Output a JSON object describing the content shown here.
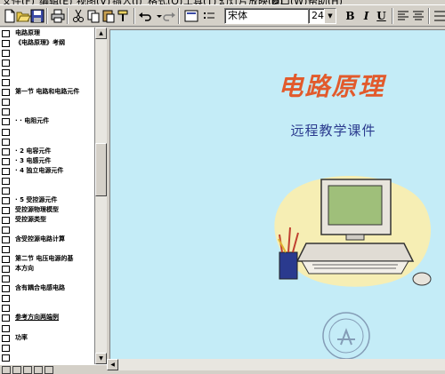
{
  "menubar": {
    "items": [
      "文件(F)",
      "编辑(E)",
      "视图(V)",
      "插入(I)",
      "格式(O)",
      "工具(T)",
      "幻灯片放映(D)",
      "窗口(W)",
      "帮助(H)"
    ]
  },
  "toolbar": {
    "font_name": "宋体",
    "font_size": "24",
    "bold_label": "B",
    "italic_label": "I",
    "underline_label": "U"
  },
  "outline": {
    "items": [
      {
        "text": "电路原理"
      },
      {
        "text": "《电路原理》考纲"
      },
      {
        "text": ""
      },
      {
        "text": ""
      },
      {
        "text": ""
      },
      {
        "text": ""
      },
      {
        "text": "第一节 电路和电路元件"
      },
      {
        "text": ""
      },
      {
        "text": ""
      },
      {
        "text": "· · 电阻元件"
      },
      {
        "text": ""
      },
      {
        "text": ""
      },
      {
        "text": "· 2 电容元件"
      },
      {
        "text": "· 3 电感元件"
      },
      {
        "text": "· 4 独立电源元件"
      },
      {
        "text": ""
      },
      {
        "text": ""
      },
      {
        "text": "· 5 受控源元件"
      },
      {
        "text": "受控源物理模型"
      },
      {
        "text": "受控源类型"
      },
      {
        "text": ""
      },
      {
        "text": "含受控源电路计算"
      },
      {
        "text": ""
      },
      {
        "text": "第二节 电压电源的基"
      },
      {
        "text": "本方向"
      },
      {
        "text": ""
      },
      {
        "text": "含有耦合电感电路"
      },
      {
        "text": ""
      },
      {
        "text": ""
      },
      {
        "text": "参考方向两端例",
        "underline": true
      },
      {
        "text": ""
      },
      {
        "text": "功率"
      },
      {
        "text": ""
      },
      {
        "text": ""
      }
    ]
  },
  "slide": {
    "title": "电路原理",
    "subtitle": "远程教学课件"
  },
  "colors": {
    "slide_bg": "#c4ecf7",
    "title": "#e25a2c",
    "subtitle": "#2a3a8e",
    "blob": "#f6eeb4"
  }
}
